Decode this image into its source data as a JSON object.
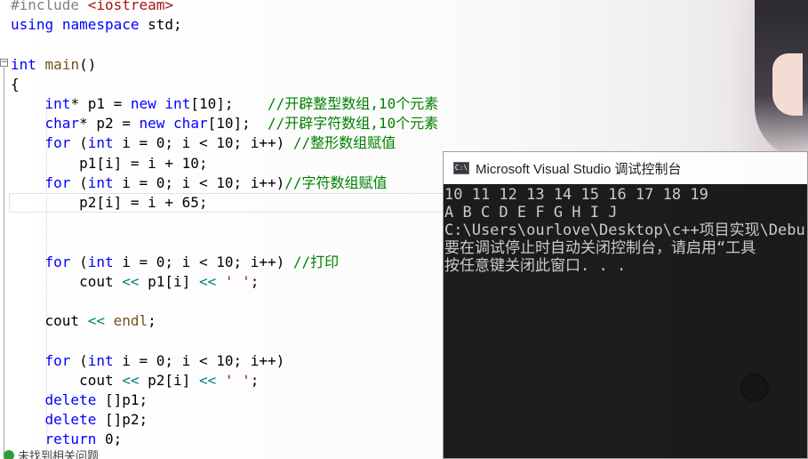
{
  "editor": {
    "lines": [
      {
        "segments": [
          {
            "t": "#include ",
            "c": "pp"
          },
          {
            "t": "<iostream>",
            "c": "str"
          }
        ]
      },
      {
        "segments": [
          {
            "t": "using",
            "c": "kw"
          },
          {
            "t": " ",
            "c": "nm"
          },
          {
            "t": "namespace",
            "c": "kw"
          },
          {
            "t": " std;",
            "c": "nm"
          }
        ]
      },
      {
        "segments": []
      },
      {
        "segments": [
          {
            "t": "int",
            "c": "kw"
          },
          {
            "t": " ",
            "c": "nm"
          },
          {
            "t": "main",
            "c": "fn"
          },
          {
            "t": "()",
            "c": "nm"
          }
        ]
      },
      {
        "segments": [
          {
            "t": "{",
            "c": "nm"
          }
        ]
      },
      {
        "segments": [
          {
            "t": "    ",
            "c": "nm"
          },
          {
            "t": "int",
            "c": "kw"
          },
          {
            "t": "* p1 = ",
            "c": "nm"
          },
          {
            "t": "new",
            "c": "kw"
          },
          {
            "t": " ",
            "c": "nm"
          },
          {
            "t": "int",
            "c": "kw"
          },
          {
            "t": "[10];    ",
            "c": "nm"
          },
          {
            "t": "//开辟整型数组,10个元素",
            "c": "cm"
          }
        ]
      },
      {
        "segments": [
          {
            "t": "    ",
            "c": "nm"
          },
          {
            "t": "char",
            "c": "kw"
          },
          {
            "t": "* p2 = ",
            "c": "nm"
          },
          {
            "t": "new",
            "c": "kw"
          },
          {
            "t": " ",
            "c": "nm"
          },
          {
            "t": "char",
            "c": "kw"
          },
          {
            "t": "[10];  ",
            "c": "nm"
          },
          {
            "t": "//开辟字符数组,10个元素",
            "c": "cm"
          }
        ]
      },
      {
        "segments": [
          {
            "t": "    ",
            "c": "nm"
          },
          {
            "t": "for",
            "c": "kw"
          },
          {
            "t": " (",
            "c": "nm"
          },
          {
            "t": "int",
            "c": "kw"
          },
          {
            "t": " i = 0; i < 10; i++) ",
            "c": "nm"
          },
          {
            "t": "//整形数组赋值",
            "c": "cm"
          }
        ]
      },
      {
        "segments": [
          {
            "t": "        p1[i] = i + 10;",
            "c": "nm"
          }
        ]
      },
      {
        "segments": [
          {
            "t": "    ",
            "c": "nm"
          },
          {
            "t": "for",
            "c": "kw"
          },
          {
            "t": " (",
            "c": "nm"
          },
          {
            "t": "int",
            "c": "kw"
          },
          {
            "t": " i = 0; i < 10; i++)",
            "c": "nm"
          },
          {
            "t": "//字符数组赋值",
            "c": "cm"
          }
        ]
      },
      {
        "segments": [
          {
            "t": "        p2[i] = i + 65;",
            "c": "nm"
          }
        ]
      },
      {
        "segments": []
      },
      {
        "segments": []
      },
      {
        "segments": [
          {
            "t": "    ",
            "c": "nm"
          },
          {
            "t": "for",
            "c": "kw"
          },
          {
            "t": " (",
            "c": "nm"
          },
          {
            "t": "int",
            "c": "kw"
          },
          {
            "t": " i = 0; i < 10; i++) ",
            "c": "nm"
          },
          {
            "t": "//打印",
            "c": "cm"
          }
        ]
      },
      {
        "segments": [
          {
            "t": "        cout ",
            "c": "nm"
          },
          {
            "t": "<<",
            "c": "op"
          },
          {
            "t": " p1[i] ",
            "c": "nm"
          },
          {
            "t": "<<",
            "c": "op"
          },
          {
            "t": " ",
            "c": "nm"
          },
          {
            "t": "' '",
            "c": "str"
          },
          {
            "t": ";",
            "c": "nm"
          }
        ]
      },
      {
        "segments": []
      },
      {
        "segments": [
          {
            "t": "    cout ",
            "c": "nm"
          },
          {
            "t": "<<",
            "c": "op"
          },
          {
            "t": " ",
            "c": "nm"
          },
          {
            "t": "endl",
            "c": "fn"
          },
          {
            "t": ";",
            "c": "nm"
          }
        ]
      },
      {
        "segments": []
      },
      {
        "segments": [
          {
            "t": "    ",
            "c": "nm"
          },
          {
            "t": "for",
            "c": "kw"
          },
          {
            "t": " (",
            "c": "nm"
          },
          {
            "t": "int",
            "c": "kw"
          },
          {
            "t": " i = 0; i < 10; i++)",
            "c": "nm"
          }
        ]
      },
      {
        "segments": [
          {
            "t": "        cout ",
            "c": "nm"
          },
          {
            "t": "<<",
            "c": "op"
          },
          {
            "t": " p2[i] ",
            "c": "nm"
          },
          {
            "t": "<<",
            "c": "op"
          },
          {
            "t": " ",
            "c": "nm"
          },
          {
            "t": "' '",
            "c": "str"
          },
          {
            "t": ";",
            "c": "nm"
          }
        ]
      },
      {
        "segments": [
          {
            "t": "    ",
            "c": "nm"
          },
          {
            "t": "delete",
            "c": "kw"
          },
          {
            "t": " []p1;",
            "c": "nm"
          }
        ]
      },
      {
        "segments": [
          {
            "t": "    ",
            "c": "nm"
          },
          {
            "t": "delete",
            "c": "kw"
          },
          {
            "t": " []p2;",
            "c": "nm"
          }
        ]
      },
      {
        "segments": [
          {
            "t": "    ",
            "c": "nm"
          },
          {
            "t": "return",
            "c": "kw"
          },
          {
            "t": " 0;",
            "c": "nm"
          }
        ]
      }
    ],
    "fold_glyph": "−",
    "status_text": "未找到相关问题"
  },
  "console": {
    "icon_label": "C:\\",
    "title": "Microsoft Visual Studio 调试控制台",
    "output": [
      "10 11 12 13 14 15 16 17 18 19",
      "A B C D E F G H I J",
      "C:\\Users\\ourlove\\Desktop\\c++项目实现\\Debu",
      "要在调试停止时自动关闭控制台，请启用“工具",
      "按任意键关闭此窗口. . ."
    ]
  },
  "colors": {
    "keyword": "#0000ff",
    "comment": "#008000",
    "string": "#a31515",
    "operator": "#008080",
    "console_bg": "#0c0c0c",
    "console_text": "#c8c8c8"
  }
}
